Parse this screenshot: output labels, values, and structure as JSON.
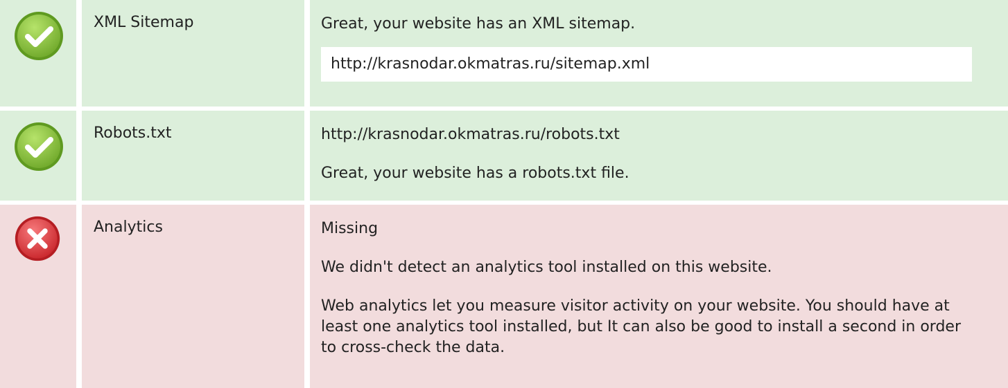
{
  "rows": [
    {
      "status": "pass",
      "icon": "check-icon",
      "name": "XML Sitemap",
      "lines": [
        "Great, your website has an XML sitemap."
      ],
      "url": "http://krasnodar.okmatras.ru/sitemap.xml"
    },
    {
      "status": "pass",
      "icon": "check-icon",
      "name": "Robots.txt",
      "lines": [
        "http://krasnodar.okmatras.ru/robots.txt",
        "Great, your website has a robots.txt file."
      ]
    },
    {
      "status": "fail",
      "icon": "cross-icon",
      "name": "Analytics",
      "lines": [
        "Missing",
        "We didn't detect an analytics tool installed on this website.",
        "Web analytics let you measure visitor activity on your website. You should have at least one analytics tool installed, but It can also be good to install a second in order to cross-check the data."
      ]
    }
  ],
  "colors": {
    "pass_bg": "#dcefdb",
    "fail_bg": "#f2dcdd",
    "check_icon": "#8bc53f",
    "cross_icon": "#e0393e"
  }
}
